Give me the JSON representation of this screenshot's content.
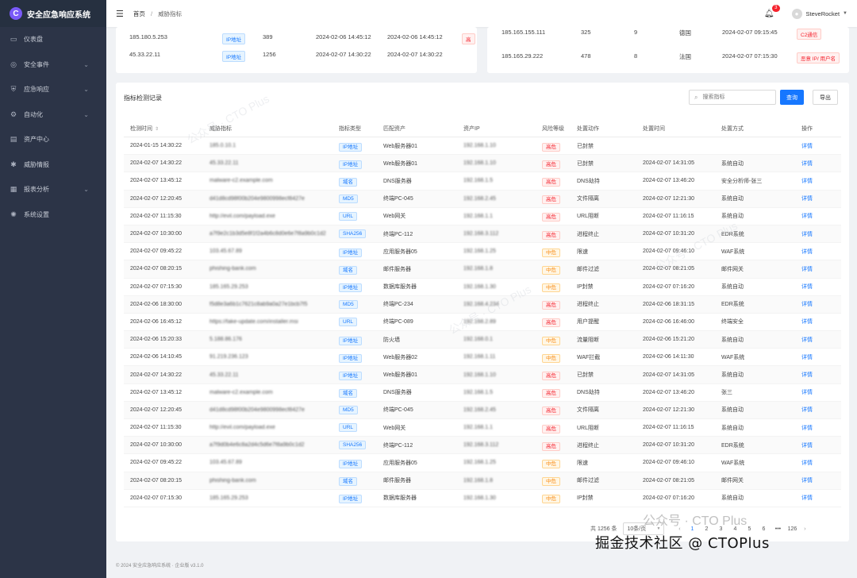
{
  "app": {
    "title": "安全应急响应系统",
    "logo_letter": "C"
  },
  "sidebar": {
    "items": [
      {
        "label": "仪表盘",
        "icon": "monitor-icon",
        "glyph": "▭",
        "chevron": false
      },
      {
        "label": "安全事件",
        "icon": "alert-icon",
        "glyph": "◎",
        "chevron": true
      },
      {
        "label": "应急响应",
        "icon": "shield-icon",
        "glyph": "⛨",
        "chevron": true
      },
      {
        "label": "自动化",
        "icon": "gear-icon",
        "glyph": "⚙",
        "chevron": true
      },
      {
        "label": "资产中心",
        "icon": "server-icon",
        "glyph": "▤",
        "chevron": false
      },
      {
        "label": "威胁情报",
        "icon": "bug-icon",
        "glyph": "✱",
        "chevron": false
      },
      {
        "label": "报表分析",
        "icon": "report-icon",
        "glyph": "▦",
        "chevron": true
      },
      {
        "label": "系统设置",
        "icon": "settings-icon",
        "glyph": "✺",
        "chevron": false
      }
    ],
    "chevron_glyph": "⌄"
  },
  "header": {
    "breadcrumb": [
      "首页",
      "威胁指标"
    ],
    "sep": "/",
    "notification_count": "3",
    "username": "SteveRocket"
  },
  "top_left_rows": [
    {
      "ip": "185.180.5.253",
      "type": "IP地址",
      "count": "389",
      "first": "2024-02-06 14:45:12",
      "last": "2024-02-06 14:45:12",
      "tag": "高"
    },
    {
      "ip": "45.33.22.11",
      "type": "IP地址",
      "count": "1256",
      "first": "2024-02-07 14:30:22",
      "last": "2024-02-07 14:30:22",
      "tag": ""
    }
  ],
  "top_right_rows": [
    {
      "ip": "185.165.155.111",
      "n1": "325",
      "n2": "9",
      "country": "德国",
      "time": "2024-02-07 09:15:45",
      "tag": "C2通信"
    },
    {
      "ip": "185.165.29.222",
      "n1": "478",
      "n2": "8",
      "country": "法国",
      "time": "2024-02-07 07:15:30",
      "tag": "恶意 IP/ 用户名"
    }
  ],
  "main": {
    "title": "指标检测记录",
    "search_placeholder": "搜索指标",
    "search_button": "查询",
    "export_button": "导出",
    "columns": [
      "检测时间",
      "威胁指标",
      "指标类型",
      "匹配资产",
      "资产IP",
      "风险等级",
      "处置动作",
      "处置时间",
      "处置方式",
      "操作"
    ],
    "sort_glyph": "⇕",
    "detail_label": "详情",
    "rows": [
      [
        "2024-01-15 14:30:22",
        "185.0.10.1",
        "IP地址",
        "Web服务器01",
        "192.168.1.10",
        "高危",
        "已封禁",
        "",
        ""
      ],
      [
        "2024-02-07 14:30:22",
        "45.33.22.11",
        "IP地址",
        "Web服务器01",
        "192.168.1.10",
        "高危",
        "已封禁",
        "2024-02-07 14:31:05",
        "系统自动"
      ],
      [
        "2024-02-07 13:45:12",
        "malware-c2.example.com",
        "域名",
        "DNS服务器",
        "192.168.1.5",
        "高危",
        "DNS劫持",
        "2024-02-07 13:46:20",
        "安全分析师-张三"
      ],
      [
        "2024-02-07 12:20:45",
        "d41d8cd98f00b204e9800998ecf8427e",
        "MD5",
        "终端PC-045",
        "192.168.2.45",
        "高危",
        "文件隔离",
        "2024-02-07 12:21:30",
        "系统自动"
      ],
      [
        "2024-02-07 11:15:30",
        "http://evil.com/payload.exe",
        "URL",
        "Web网关",
        "192.168.1.1",
        "高危",
        "URL阻断",
        "2024-02-07 11:16:15",
        "系统自动"
      ],
      [
        "2024-02-07 10:30:00",
        "a7f9e2c1b3d5e8f1f2a4b6c8d0e6e7f8a9b0c1d2",
        "SHA256",
        "终端PC-112",
        "192.168.3.112",
        "高危",
        "进程终止",
        "2024-02-07 10:31:20",
        "EDR系统"
      ],
      [
        "2024-02-07 09:45:22",
        "103.45.67.89",
        "IP地址",
        "应用服务器05",
        "192.168.1.25",
        "中危",
        "限速",
        "2024-02-07 09:46:10",
        "WAF系统"
      ],
      [
        "2024-02-07 08:20:15",
        "phishing-bank.com",
        "域名",
        "邮件服务器",
        "192.168.1.8",
        "中危",
        "邮件过滤",
        "2024-02-07 08:21:05",
        "邮件网关"
      ],
      [
        "2024-02-07 07:15:30",
        "185.165.29.253",
        "IP地址",
        "数据库服务器",
        "192.168.1.30",
        "中危",
        "IP封禁",
        "2024-02-07 07:16:20",
        "系统自动"
      ],
      [
        "2024-02-06 18:30:00",
        "f5d8e3a6b1c7621c8ab9a0a27e1bcb7f5",
        "MD5",
        "终端PC-234",
        "192.168.4.234",
        "高危",
        "进程终止",
        "2024-02-06 18:31:15",
        "EDR系统"
      ],
      [
        "2024-02-06 16:45:12",
        "https://fake-update.com/installer.msi",
        "URL",
        "终端PC-089",
        "192.168.2.89",
        "高危",
        "用户提醒",
        "2024-02-06 16:46:00",
        "终端安全"
      ],
      [
        "2024-02-06 15:20:33",
        "5.188.86.176",
        "IP地址",
        "防火墙",
        "192.168.0.1",
        "中危",
        "流量阻断",
        "2024-02-06 15:21:20",
        "系统自动"
      ],
      [
        "2024-02-06 14:10:45",
        "91.219.236.123",
        "IP地址",
        "Web服务器02",
        "192.168.1.11",
        "中危",
        "WAF拦截",
        "2024-02-06 14:11:30",
        "WAF系统"
      ],
      [
        "2024-02-07 14:30:22",
        "45.33.22.11",
        "IP地址",
        "Web服务器01",
        "192.168.1.10",
        "高危",
        "已封禁",
        "2024-02-07 14:31:05",
        "系统自动"
      ],
      [
        "2024-02-07 13:45:12",
        "malware-c2.example.com",
        "域名",
        "DNS服务器",
        "192.168.1.5",
        "高危",
        "DNS劫持",
        "2024-02-07 13:46:20",
        "张三"
      ],
      [
        "2024-02-07 12:20:45",
        "d41d8cd98f00b204e9800998ecf8427e",
        "MD5",
        "终端PC-045",
        "192.168.2.45",
        "高危",
        "文件隔离",
        "2024-02-07 12:21:30",
        "系统自动"
      ],
      [
        "2024-02-07 11:15:30",
        "http://evil.com/payload.exe",
        "URL",
        "Web网关",
        "192.168.1.1",
        "高危",
        "URL阻断",
        "2024-02-07 11:16:15",
        "系统自动"
      ],
      [
        "2024-02-07 10:30:00",
        "a7f9d0b4e6c8a2d4c5d6e7f8a9b0c1d2",
        "SHA256",
        "终端PC-112",
        "192.168.3.112",
        "高危",
        "进程终止",
        "2024-02-07 10:31:20",
        "EDR系统"
      ],
      [
        "2024-02-07 09:45:22",
        "103.45.67.89",
        "IP地址",
        "应用服务器05",
        "192.168.1.25",
        "中危",
        "限速",
        "2024-02-07 09:46:10",
        "WAF系统"
      ],
      [
        "2024-02-07 08:20:15",
        "phishing-bank.com",
        "域名",
        "邮件服务器",
        "192.168.1.8",
        "中危",
        "邮件过滤",
        "2024-02-07 08:21:05",
        "邮件网关"
      ],
      [
        "2024-02-07 07:15:30",
        "185.165.29.253",
        "IP地址",
        "数据库服务器",
        "192.168.1.30",
        "中危",
        "IP封禁",
        "2024-02-07 07:16:20",
        "系统自动"
      ]
    ]
  },
  "pagination": {
    "total": "共 1256 条",
    "page_size": "10条/页",
    "pages": [
      "1",
      "2",
      "3",
      "4",
      "5",
      "6",
      "•••",
      "126"
    ],
    "active": "1",
    "prev": "‹",
    "next": "›"
  },
  "footer": {
    "text": "© 2024 安全应急响应系统 · 企业版 v3.1.0"
  },
  "watermark": {
    "main": "掘金技术社区 @ CTOPlus",
    "sub": "公众号 · CTO Plus"
  },
  "colors": {
    "sidebar": "#2c3447",
    "primary": "#1677ff",
    "high": "#f5222d",
    "medium": "#fa8c16"
  }
}
